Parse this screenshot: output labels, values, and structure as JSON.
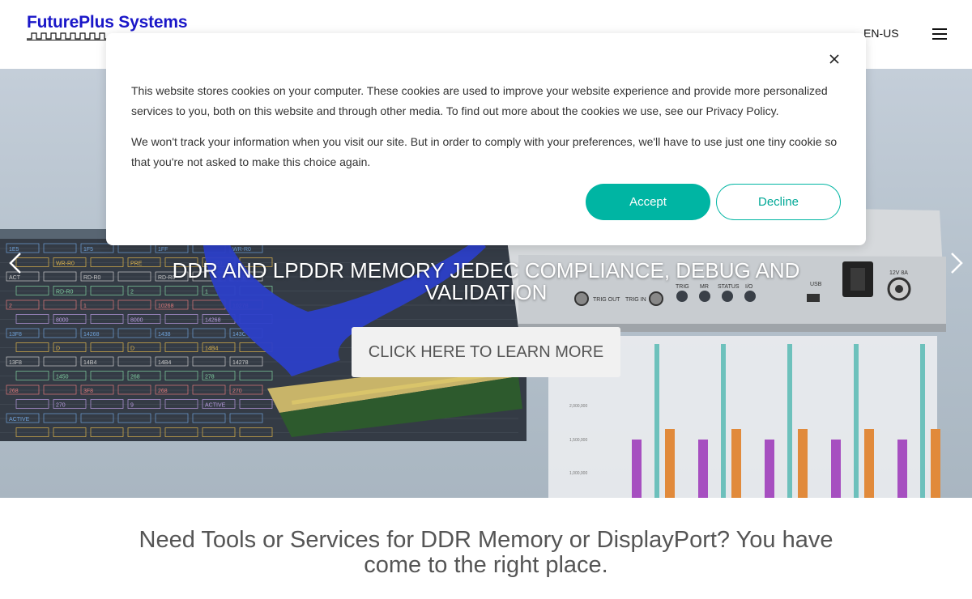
{
  "header": {
    "logo_text": "FuturePlus Systems",
    "language": "EN-US",
    "menu_icon": "hamburger-menu-icon"
  },
  "hero": {
    "title": "DDR AND LPDDR MEMORY JEDEC COMPLIANCE, DEBUG AND VALIDATION",
    "cta": "CLICK HERE TO LEARN MORE",
    "prev_icon": "chevron-left-icon",
    "next_icon": "chevron-right-icon",
    "device_labels": [
      "TRIG OUT",
      "TRIG IN",
      "TRIG",
      "MR",
      "STATUS",
      "I/O",
      "USB",
      "12V 8A"
    ],
    "waveform_labels": [
      "1E5",
      "1F5",
      "1FF",
      "WR-R0",
      "WR-R0",
      "PRE",
      "RD-R0",
      "ACT",
      "RD-R0",
      "RD-R0",
      "RD-R0",
      "RD-R0",
      "2",
      "1",
      "2",
      "1",
      "10268",
      "10278",
      "8000",
      "8000",
      "14268",
      "13F8",
      "14268",
      "1438",
      "143C",
      "D",
      "D",
      "14B4",
      "13F8",
      "14B4",
      "14B4",
      "14278",
      "1450",
      "268",
      "278",
      "268",
      "3F8",
      "268",
      "270",
      "270",
      "9",
      "ACTIVE",
      "ACTIVE"
    ],
    "chart_ticks": [
      "2,000,000",
      "1,500,000",
      "1,000,000"
    ]
  },
  "cookie": {
    "text1": "This website stores cookies on your computer. These cookies are used to improve your website experience and provide more personalized services to you, both on this website and through other media. To find out more about the cookies we use, see our Privacy Policy.",
    "text2": "We won't track your information when you visit our site. But in order to comply with your preferences, we'll have to use just one tiny cookie so that you're not asked to make this choice again.",
    "accept": "Accept",
    "decline": "Decline",
    "close_icon": "close-icon"
  },
  "tagline": "Need Tools or Services for DDR Memory or DisplayPort? You have come to the right place.",
  "colors": {
    "brand": "#1a17c8",
    "accent": "#00b5a3"
  }
}
